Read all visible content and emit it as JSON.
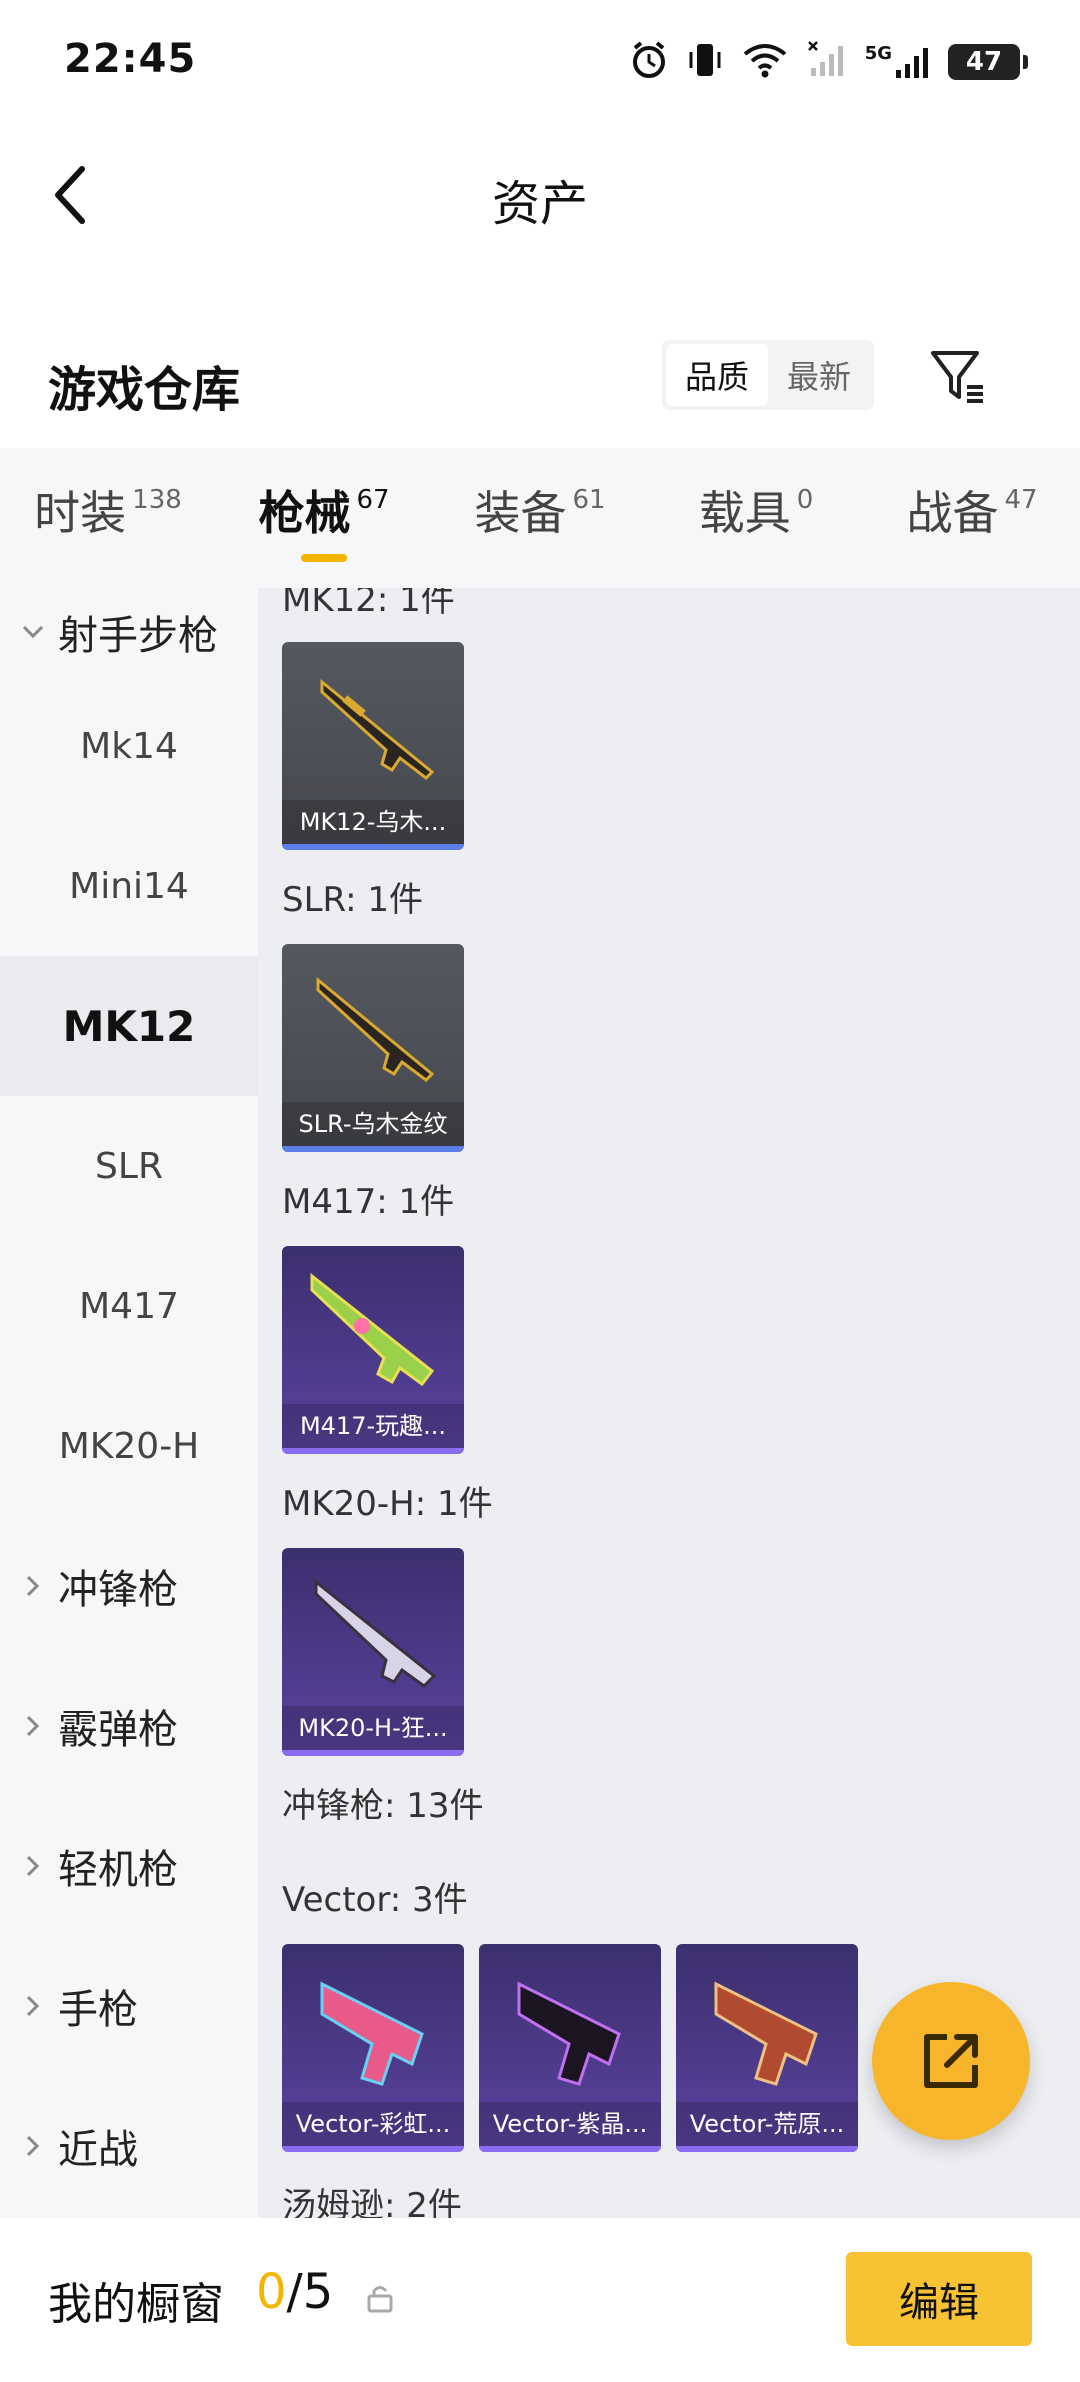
{
  "status_bar": {
    "time": "22:45",
    "network_label": "5G",
    "battery": "47"
  },
  "header": {
    "title": "资产"
  },
  "warehouse": {
    "title": "游戏仓库",
    "sort_options": [
      "品质",
      "最新"
    ],
    "active_sort": "品质"
  },
  "tabs": [
    {
      "label": "时装",
      "count": "138"
    },
    {
      "label": "枪械",
      "count": "67",
      "active": true
    },
    {
      "label": "装备",
      "count": "61"
    },
    {
      "label": "载具",
      "count": "0"
    },
    {
      "label": "战备",
      "count": "47"
    }
  ],
  "sidebar": {
    "group_open": "射手步枪",
    "sub_items": [
      "Mk14",
      "Mini14",
      "MK12",
      "SLR",
      "M417",
      "MK20-H"
    ],
    "active_item": "MK12",
    "groups_closed": [
      "冲锋枪",
      "霰弹枪",
      "轻机枪",
      "手枪",
      "近战"
    ]
  },
  "content": {
    "sections": [
      {
        "label": "MK12: 1件",
        "items": [
          {
            "name": "MK12-乌木...",
            "style": "grey"
          }
        ]
      },
      {
        "label": "SLR: 1件",
        "items": [
          {
            "name": "SLR-乌木金纹",
            "style": "grey"
          }
        ]
      },
      {
        "label": "M417: 1件",
        "items": [
          {
            "name": "M417-玩趣...",
            "style": "purple"
          }
        ]
      },
      {
        "label": "MK20-H: 1件",
        "items": [
          {
            "name": "MK20-H-狂...",
            "style": "purple"
          }
        ]
      },
      {
        "label": "冲锋枪: 13件",
        "items": []
      },
      {
        "label": "Vector: 3件",
        "items": [
          {
            "name": "Vector-彩虹...",
            "style": "purple"
          },
          {
            "name": "Vector-紫晶...",
            "style": "purple"
          },
          {
            "name": "Vector-荒原...",
            "style": "purple"
          }
        ]
      },
      {
        "label": "汤姆逊: 2件",
        "items": []
      }
    ]
  },
  "bottom_bar": {
    "label": "我的橱窗",
    "current": "0",
    "total": "/5",
    "edit_label": "编辑"
  },
  "colors": {
    "accent": "#f5b400",
    "fab": "#f7b52c",
    "edit_button": "#f7c233"
  }
}
